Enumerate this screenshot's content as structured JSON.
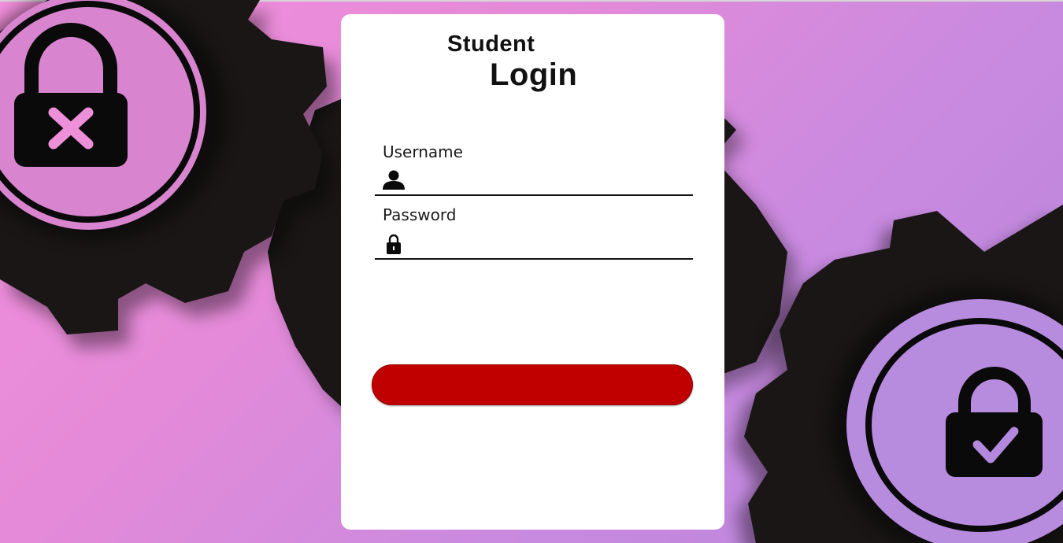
{
  "login_card": {
    "title_line1": "Student",
    "title_line2": "Login",
    "username": {
      "label": "Username",
      "value": "",
      "placeholder": "",
      "icon": "user-icon"
    },
    "password": {
      "label": "Password",
      "value": "",
      "placeholder": "",
      "icon": "lock-icon"
    },
    "submit_label": ""
  },
  "background": {
    "left_icon": "locked-padlock-x-icon",
    "right_icon": "unlocked-padlock-check-icon",
    "gear_color": "#1a1616",
    "x_mark_color": "#ee8fd9",
    "check_mark_color": "#b488dc"
  },
  "colors": {
    "gradient_start": "#f48fdc",
    "gradient_end": "#b685db",
    "button": "#c00000",
    "card": "#ffffff"
  }
}
